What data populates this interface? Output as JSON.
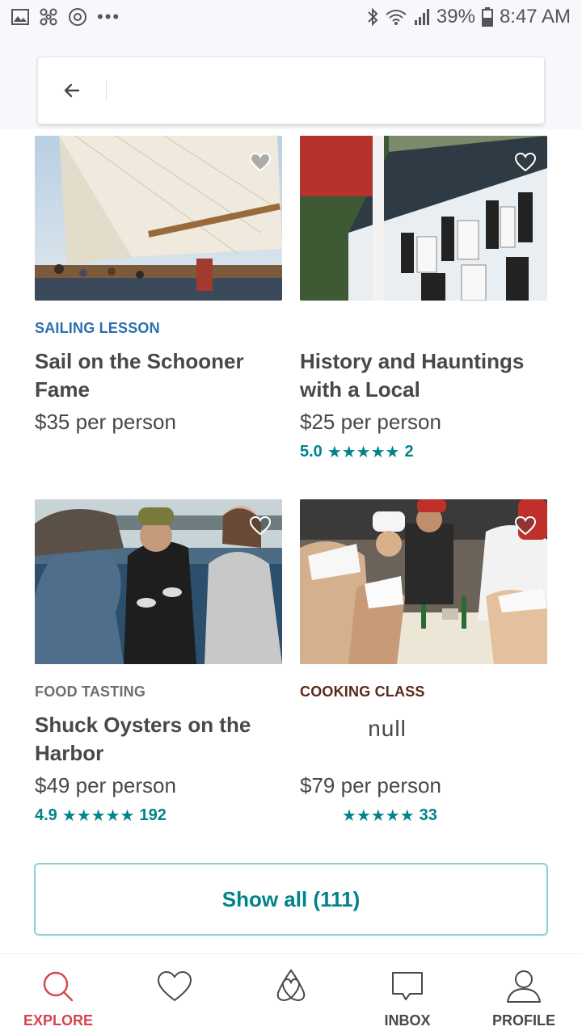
{
  "status_bar": {
    "dots": "•••",
    "battery": "39%",
    "time": "8:47 AM"
  },
  "search": {
    "back_icon": "arrow-left-icon",
    "query": ""
  },
  "cards": [
    {
      "category": "SAILING LESSON",
      "category_color": "#2b6fae",
      "title": "Sail on the Schooner Fame",
      "price": "$35 per person",
      "rating": "",
      "reviews": ""
    },
    {
      "category": "",
      "category_color": "#484848",
      "title": "History and Hauntings with a Local",
      "price": "$25 per person",
      "rating": "5.0",
      "stars": "★★★★★",
      "reviews": "2"
    },
    {
      "category": "FOOD TASTING",
      "category_color": "#6e6e6e",
      "title": "Shuck Oysters on the Harbor",
      "price": "$49 per person",
      "rating": "4.9",
      "stars": "★★★★★",
      "reviews": "192"
    },
    {
      "category": "COOKING CLASS",
      "category_color": "#5a2a1a",
      "title": "null",
      "price": "$79 per person",
      "rating": "",
      "stars": "★★★★★",
      "reviews": "33"
    }
  ],
  "show_all": "Show all (111)",
  "bottom_nav": [
    {
      "label": "EXPLORE",
      "icon": "search-icon",
      "active": true
    },
    {
      "label": "",
      "icon": "heart-icon"
    },
    {
      "label": "",
      "icon": "airbnb-logo-icon"
    },
    {
      "label": "INBOX",
      "icon": "chat-icon"
    },
    {
      "label": "PROFILE",
      "icon": "person-icon"
    }
  ],
  "colors": {
    "accent_teal": "#00848a",
    "active_red": "#d9434b"
  }
}
